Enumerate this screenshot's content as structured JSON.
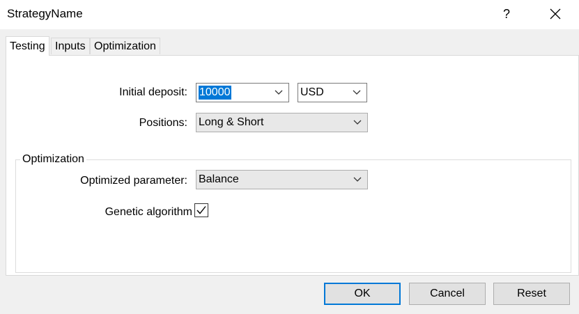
{
  "window": {
    "title": "StrategyName",
    "help_label": "?"
  },
  "tabs": [
    {
      "label": "Testing",
      "active": true
    },
    {
      "label": "Inputs",
      "active": false
    },
    {
      "label": "Optimization",
      "active": false
    }
  ],
  "testing": {
    "initial_deposit": {
      "label": "Initial deposit:",
      "value": "10000",
      "currency": "USD"
    },
    "positions": {
      "label": "Positions:",
      "value": "Long & Short"
    }
  },
  "optimization_group": {
    "title": "Optimization",
    "optimized_parameter": {
      "label": "Optimized parameter:",
      "value": "Balance"
    },
    "genetic_algorithm": {
      "label": "Genetic algorithm",
      "checked": true
    }
  },
  "buttons": {
    "ok": "OK",
    "cancel": "Cancel",
    "reset": "Reset"
  },
  "colors": {
    "accent": "#0078d7",
    "dialog_bg": "#f0f0f0",
    "panel_bg": "#ffffff"
  }
}
